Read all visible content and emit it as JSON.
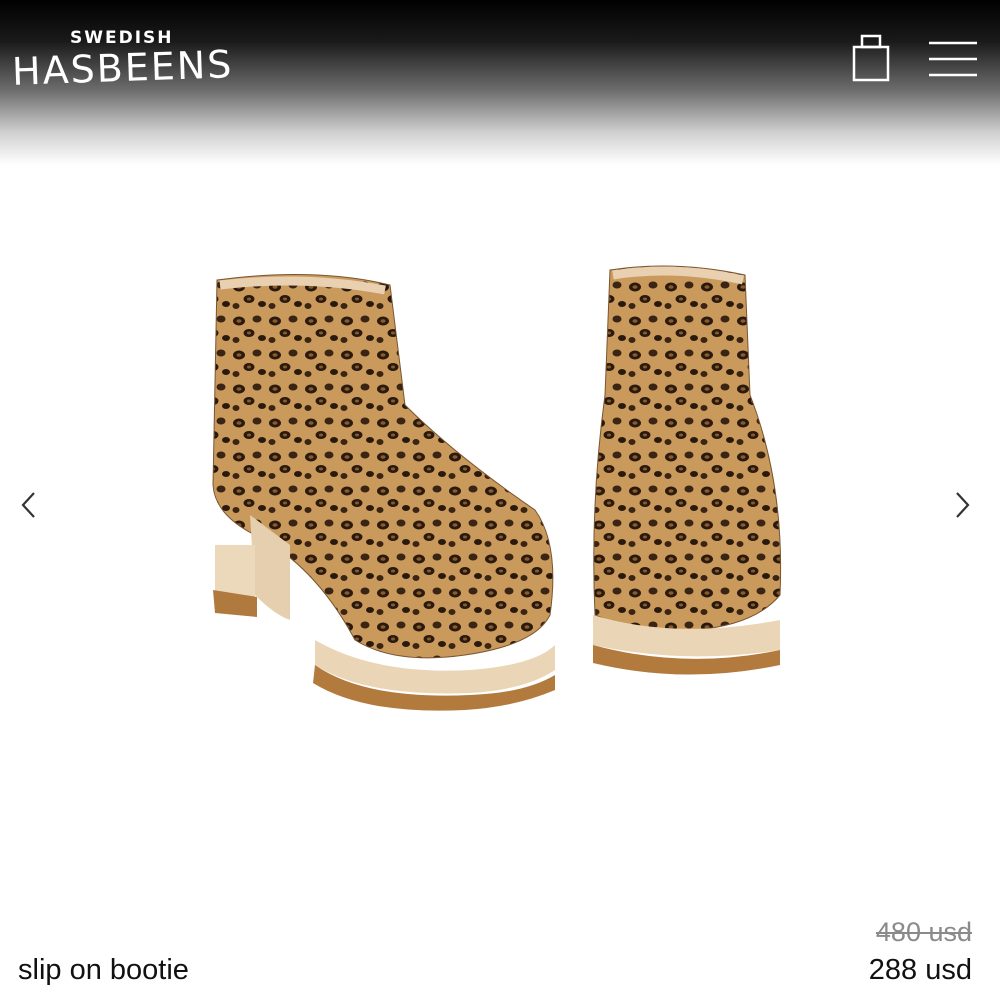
{
  "header": {
    "logo_top": "SWEDISH",
    "logo_main": "HASBEENS",
    "bag_icon": "shopping-bag-icon",
    "menu_icon": "hamburger-menu-icon"
  },
  "gallery": {
    "image_subject": "leopard print clog booties",
    "prev_icon": "chevron-left-icon",
    "next_icon": "chevron-right-icon"
  },
  "product": {
    "name": "slip on bootie",
    "original_price": "480 usd",
    "sale_price": "288 usd"
  },
  "colors": {
    "header_top": "#000000",
    "background": "#ffffff",
    "text": "#111111",
    "strike_price": "#8a8a8a"
  }
}
